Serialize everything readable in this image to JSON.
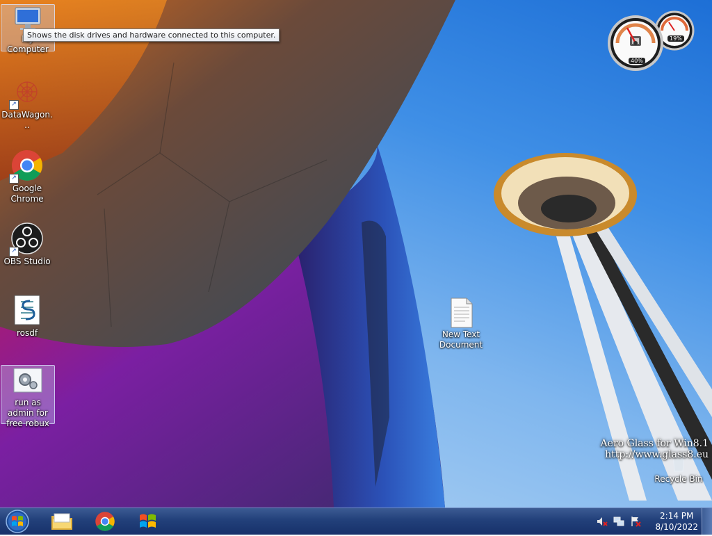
{
  "desktop": {
    "icons": [
      {
        "label": "My Computer",
        "icon": "computer-icon"
      },
      {
        "label": "DataWagon...",
        "icon": "datawagon-icon"
      },
      {
        "label": "Google Chrome",
        "icon": "chrome-icon"
      },
      {
        "label": "OBS Studio",
        "icon": "obs-icon"
      },
      {
        "label": "rosdf",
        "icon": "script-icon"
      },
      {
        "label": "run as admin for free robux",
        "icon": "settings-gear-icon"
      },
      {
        "label": "New Text Document",
        "icon": "text-document-icon"
      },
      {
        "label": "Recycle Bin",
        "icon": "recycle-bin-icon"
      }
    ],
    "tooltip": "Shows the disk drives and hardware connected to this computer."
  },
  "gadgets": {
    "cpu": "40%",
    "memory": "19%"
  },
  "watermark": {
    "line1": "Aero Glass for Win8.1",
    "line2": "http://www.glass8.eu"
  },
  "taskbar": {
    "start_icon": "windows-orb-icon",
    "pinned": [
      {
        "name": "file-explorer-icon"
      },
      {
        "name": "chrome-icon"
      },
      {
        "name": "windows-flag-icon"
      }
    ],
    "clock": {
      "time": "2:14 PM",
      "date": "8/10/2022"
    }
  },
  "colors": {
    "taskbar": "#22407a",
    "sky": "#3f8fe6"
  }
}
